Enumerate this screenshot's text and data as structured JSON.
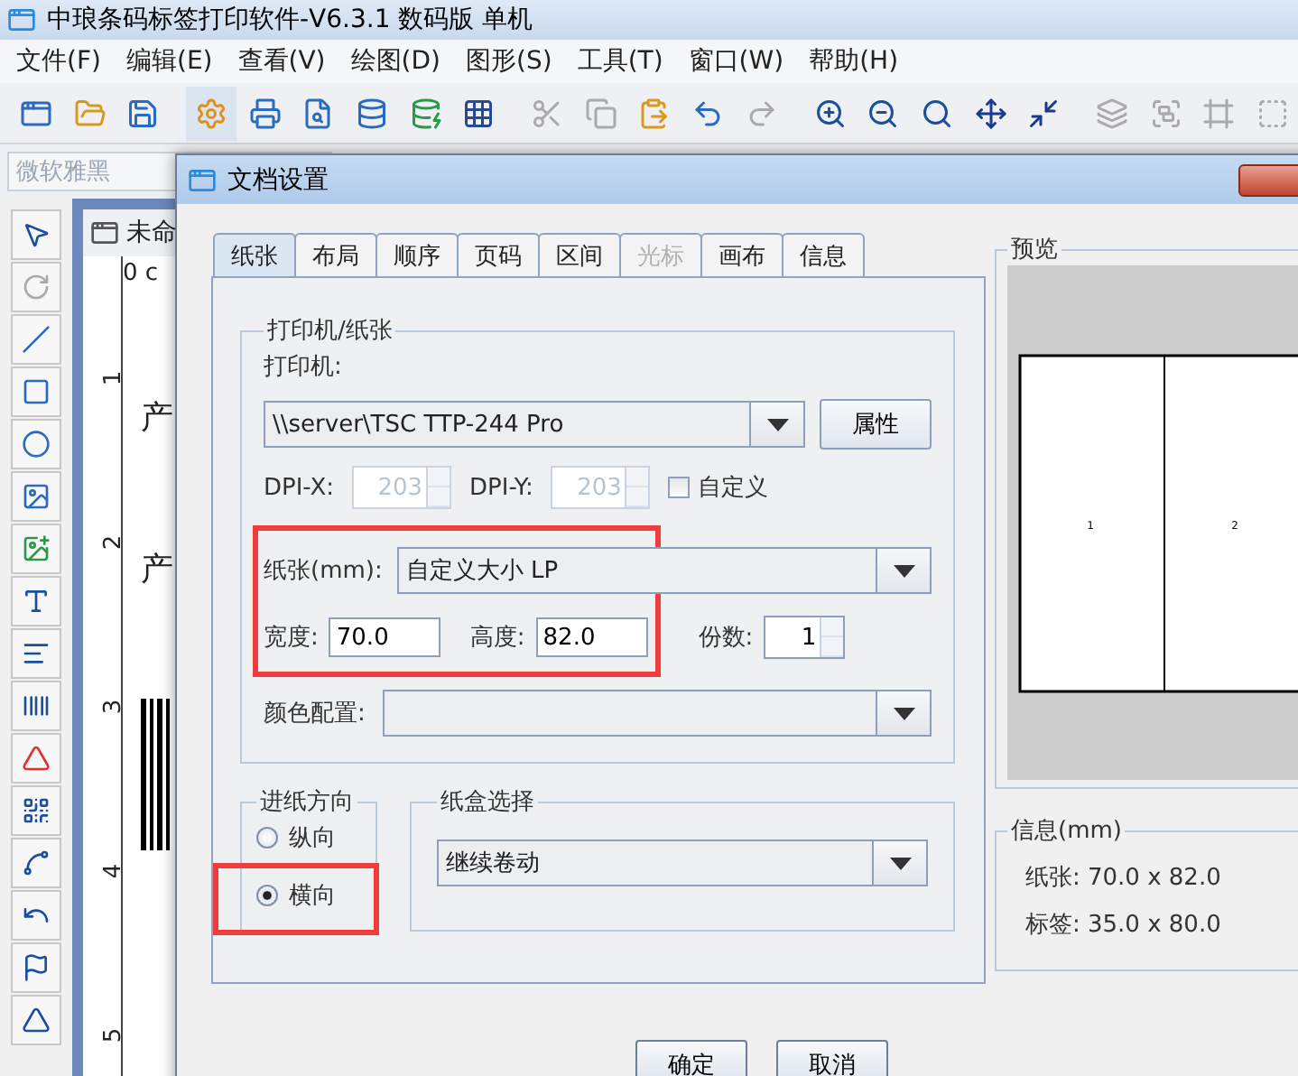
{
  "app": {
    "title": "中琅条码标签打印软件-V6.3.1 数码版 单机"
  },
  "menu": [
    "文件(F)",
    "编辑(E)",
    "查看(V)",
    "绘图(D)",
    "图形(S)",
    "工具(T)",
    "窗口(W)",
    "帮助(H)"
  ],
  "font_field": {
    "value": "微软雅黑",
    "disabled": true
  },
  "document": {
    "tab_title": "未命",
    "ruler_unit": "0 c",
    "ruler_numbers": [
      "1",
      "2",
      "3",
      "4",
      "5"
    ],
    "canvas_texts": [
      "产",
      "产"
    ]
  },
  "dialog": {
    "title": "文档设置",
    "tabs": [
      {
        "label": "纸张",
        "selected": true,
        "disabled": false
      },
      {
        "label": "布局",
        "selected": false,
        "disabled": false
      },
      {
        "label": "顺序",
        "selected": false,
        "disabled": false
      },
      {
        "label": "页码",
        "selected": false,
        "disabled": false
      },
      {
        "label": "区间",
        "selected": false,
        "disabled": false
      },
      {
        "label": "光标",
        "selected": false,
        "disabled": true
      },
      {
        "label": "画布",
        "selected": false,
        "disabled": false
      },
      {
        "label": "信息",
        "selected": false,
        "disabled": false
      }
    ],
    "printer_group": {
      "title": "打印机/纸张",
      "printer_label": "打印机:",
      "printer_value": "\\\\server\\TSC TTP-244 Pro",
      "properties_button": "属性",
      "dpi_x": {
        "label": "DPI-X:",
        "value": "203",
        "disabled": true
      },
      "dpi_y": {
        "label": "DPI-Y:",
        "value": "203",
        "disabled": true
      },
      "custom": {
        "label": "自定义",
        "checked": false
      },
      "paper": {
        "label": "纸张(mm):",
        "value": "自定义大小 LP"
      },
      "width": {
        "label": "宽度:",
        "value": "70.0"
      },
      "height": {
        "label": "高度:",
        "value": "82.0"
      },
      "copies": {
        "label": "份数:",
        "value": "1"
      },
      "color": {
        "label": "颜色配置:"
      }
    },
    "feed": {
      "title": "进纸方向",
      "options": [
        {
          "label": "纵向",
          "selected": false
        },
        {
          "label": "横向",
          "selected": true
        }
      ]
    },
    "tray": {
      "title": "纸盒选择",
      "value": "继续卷动"
    },
    "preview": {
      "title": "预览",
      "labels": [
        "1",
        "2"
      ]
    },
    "info": {
      "title": "信息(mm)",
      "rows": [
        "纸张: 70.0 x 82.0",
        "标签: 35.0 x 80.0"
      ]
    },
    "buttons": [
      "确定",
      "取消"
    ]
  }
}
